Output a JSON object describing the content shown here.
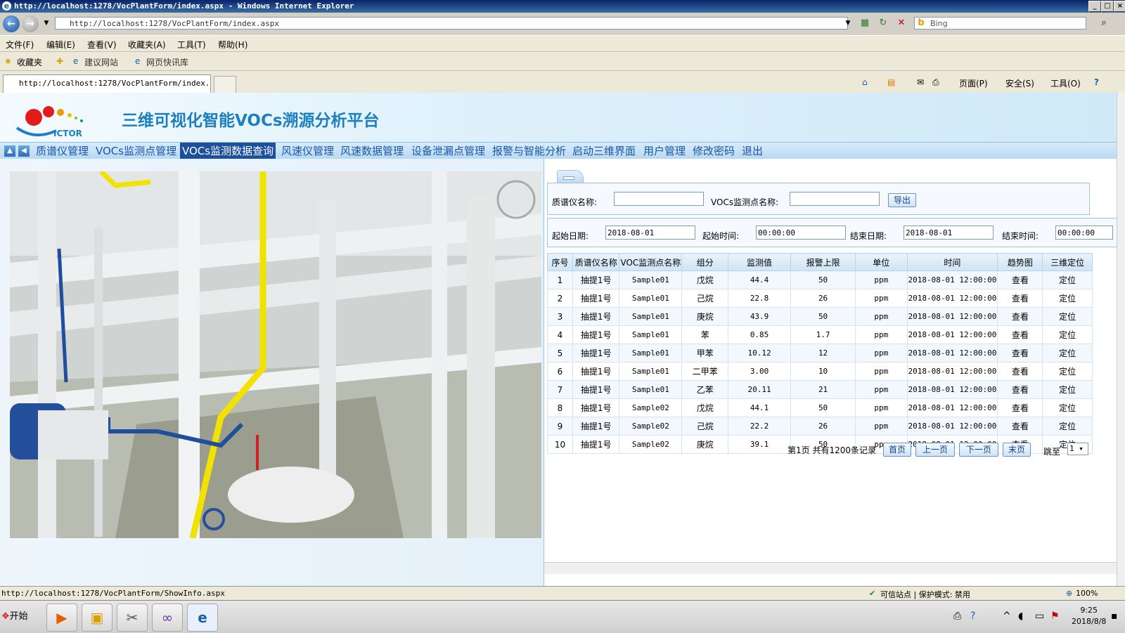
{
  "browser": {
    "title": "http://localhost:1278/VocPlantForm/index.aspx - Windows Internet Explorer",
    "address": "http://localhost:1278/VocPlantForm/index.aspx",
    "search_placeholder": "Bing",
    "menu": [
      "文件(F)",
      "编辑(E)",
      "查看(V)",
      "收藏夹(A)",
      "工具(T)",
      "帮助(H)"
    ],
    "favorites": {
      "label": "收藏夹",
      "items": [
        "建议网站",
        "网页快讯库"
      ]
    },
    "tab_title": "http://localhost:1278/VocPlantForm/index....",
    "commands": [
      "页面(P)",
      "安全(S)",
      "工具(O)"
    ]
  },
  "app": {
    "logo_text": "ICTOR",
    "title": "三维可视化智能VOCs溯源分析平台",
    "nav": [
      "质谱仪管理",
      "VOCs监测点管理",
      "VOCs监测数据查询",
      "风速仪管理",
      "风速数据管理",
      "设备泄漏点管理",
      "报警与智能分析",
      "启动三维界面",
      "用户管理",
      "修改密码",
      "退出"
    ],
    "nav_active_index": 2
  },
  "filters": {
    "ms_name_label": "质谱仪名称:",
    "ms_name_value": "",
    "voc_point_label": "VOCs监测点名称:",
    "voc_point_value": "",
    "export_label": "导出",
    "start_date_label": "起始日期:",
    "start_date_value": "2018-08-01",
    "start_time_label": "起始时间:",
    "start_time_value": "00:00:00",
    "end_date_label": "结束日期:",
    "end_date_value": "2018-08-01",
    "end_time_label": "结束时间:",
    "end_time_value": "00:00:00"
  },
  "table": {
    "columns": [
      "序号",
      "质谱仪名称",
      "VOC监测点名称",
      "组分",
      "监测值",
      "报警上限",
      "单位",
      "时间",
      "趋势图",
      "三维定位"
    ],
    "rows": [
      [
        "1",
        "抽提1号",
        "Sample01",
        "戊烷",
        "44.4",
        "50",
        "ppm",
        "2018-08-01 12:00:00",
        "查看",
        "定位"
      ],
      [
        "2",
        "抽提1号",
        "Sample01",
        "己烷",
        "22.8",
        "26",
        "ppm",
        "2018-08-01 12:00:00",
        "查看",
        "定位"
      ],
      [
        "3",
        "抽提1号",
        "Sample01",
        "庚烷",
        "43.9",
        "50",
        "ppm",
        "2018-08-01 12:00:00",
        "查看",
        "定位"
      ],
      [
        "4",
        "抽提1号",
        "Sample01",
        "苯",
        "0.85",
        "1.7",
        "ppm",
        "2018-08-01 12:00:00",
        "查看",
        "定位"
      ],
      [
        "5",
        "抽提1号",
        "Sample01",
        "甲苯",
        "10.12",
        "12",
        "ppm",
        "2018-08-01 12:00:00",
        "查看",
        "定位"
      ],
      [
        "6",
        "抽提1号",
        "Sample01",
        "二甲苯",
        "3.00",
        "10",
        "ppm",
        "2018-08-01 12:00:00",
        "查看",
        "定位"
      ],
      [
        "7",
        "抽提1号",
        "Sample01",
        "乙苯",
        "20.11",
        "21",
        "ppm",
        "2018-08-01 12:00:00",
        "查看",
        "定位"
      ],
      [
        "8",
        "抽提1号",
        "Sample02",
        "戊烷",
        "44.1",
        "50",
        "ppm",
        "2018-08-01 12:00:00",
        "查看",
        "定位"
      ],
      [
        "9",
        "抽提1号",
        "Sample02",
        "己烷",
        "22.2",
        "26",
        "ppm",
        "2018-08-01 12:00:00",
        "查看",
        "定位"
      ],
      [
        "10",
        "抽提1号",
        "Sample02",
        "庚烷",
        "39.1",
        "50",
        "ppm",
        "2018-08-01 12:00:00",
        "查看",
        "定位"
      ]
    ]
  },
  "pager": {
    "info": "第1页 共有1200条记录",
    "first": "首页",
    "prev": "上一页",
    "next": "下一页",
    "last": "末页",
    "jump_label": "跳至",
    "page_value": "1"
  },
  "status": {
    "url": "http://localhost:1278/VocPlantForm/ShowInfo.aspx",
    "zone": "可信站点 | 保护模式: 禁用",
    "zoom": "100%"
  },
  "taskbar": {
    "start": "开始",
    "time": "9:25",
    "date": "2018/8/8"
  }
}
